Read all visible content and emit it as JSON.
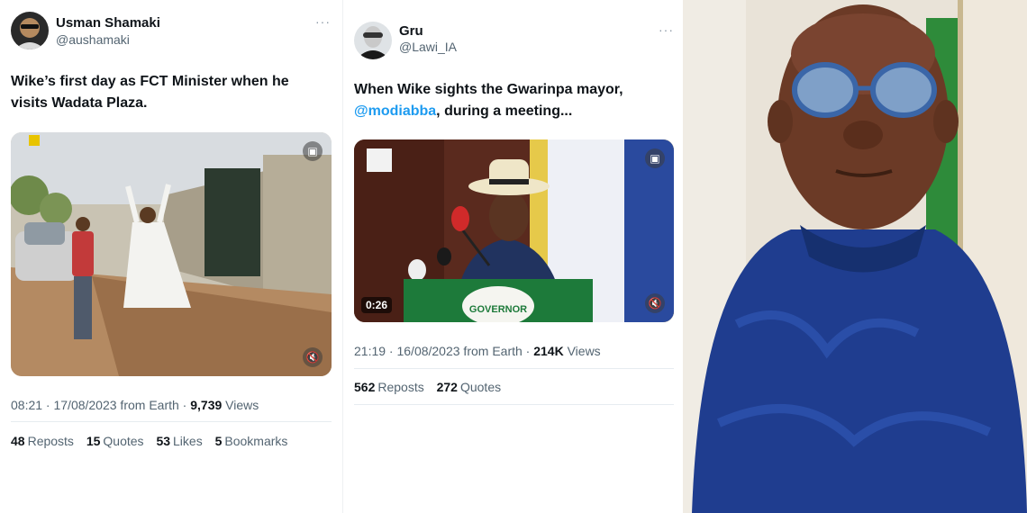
{
  "tweet1": {
    "name": "Usman Shamaki",
    "handle": "@aushamaki",
    "more": "···",
    "text": "Wike’s first day as FCT Minister when he visits Wadata Plaza.",
    "time": "08:21 · 17/08/2023 from Earth · ",
    "views_count": "9,739",
    "views_label": " Views",
    "stats": [
      {
        "count": "48",
        "label": "Reposts"
      },
      {
        "count": "15",
        "label": "Quotes"
      },
      {
        "count": "53",
        "label": "Likes"
      },
      {
        "count": "5",
        "label": "Bookmarks"
      }
    ],
    "media_icon": "gallery-icon",
    "mute_icon": "mute-icon"
  },
  "tweet2": {
    "name": "Gru",
    "handle": "@Lawi_IA",
    "more": "···",
    "text_before": "When Wike sights the Gwarinpa mayor, ",
    "mention": "@modiabba",
    "text_after": ", during a meeting...",
    "timecode": "0:26",
    "time": "21:19 · 16/08/2023 from Earth · ",
    "views_count": "214K",
    "views_label": " Views",
    "stats": [
      {
        "count": "562",
        "label": "Reposts"
      },
      {
        "count": "272",
        "label": "Quotes"
      }
    ],
    "podium_text": "GOVERNOR"
  },
  "colors": {
    "link": "#1d9bf0",
    "muted": "#536471",
    "agbada_blue": "#1f3d8f",
    "flag_green": "#2e8b3a"
  }
}
